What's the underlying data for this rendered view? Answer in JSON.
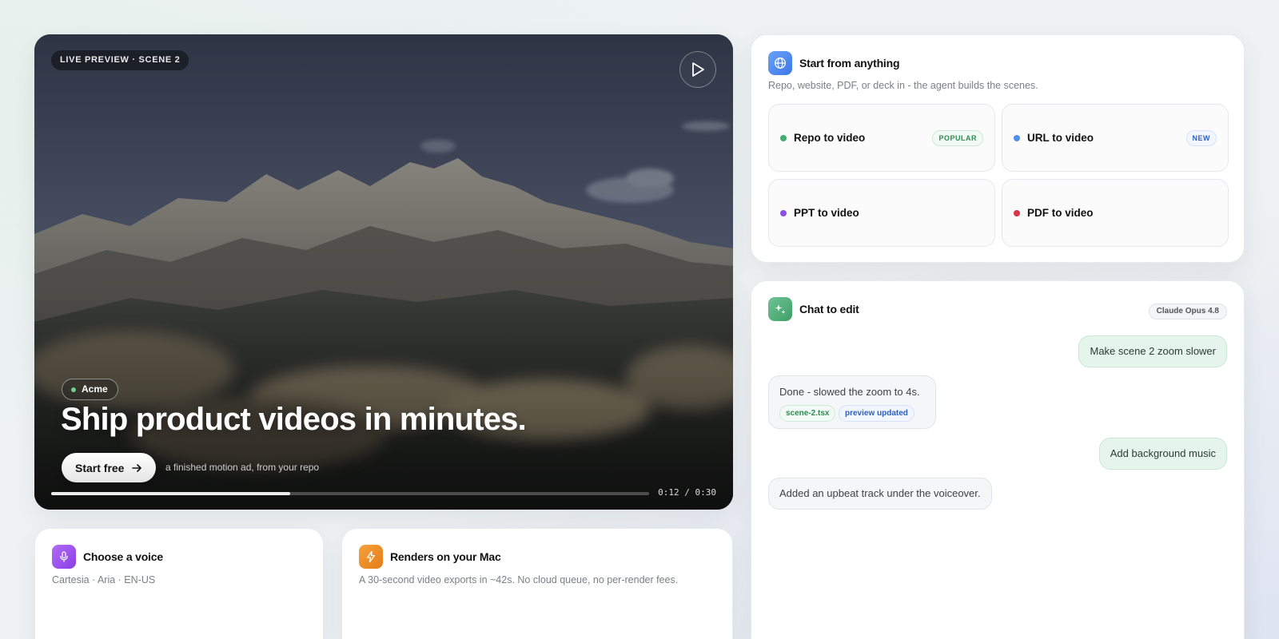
{
  "hero": {
    "live_label": "LIVE PREVIEW · SCENE 2",
    "brand": "Acme",
    "title": "Ship product videos in minutes.",
    "cta_label": "Start free",
    "caption": "a finished motion ad, from your repo",
    "progress_fraction": 0.4,
    "time": "0:12 / 0:30",
    "icons": {
      "play": "play-icon",
      "arrow": "arrow-right-icon"
    }
  },
  "start_card": {
    "title": "Start from anything",
    "subtitle": "Repo, website, PDF, or deck in - the agent builds the scenes.",
    "icon": "globe-icon",
    "options": [
      {
        "label": "Repo to video",
        "dot_color": "#3fae6a",
        "badge": "POPULAR"
      },
      {
        "label": "URL to video",
        "dot_color": "#4f8ff0",
        "badge": "NEW"
      },
      {
        "label": "PPT to video",
        "dot_color": "#8b4fe6",
        "badge": ""
      },
      {
        "label": "PDF to video",
        "dot_color": "#d8344b",
        "badge": ""
      }
    ]
  },
  "chat_card": {
    "title": "Chat to edit",
    "icon": "sparkle-icon",
    "model": "Claude Opus 4.8",
    "messages": [
      {
        "role": "user",
        "text": "Make scene 2 zoom slower"
      },
      {
        "role": "agent",
        "text": "Done - slowed the zoom to 4s.",
        "tags": [
          "scene-2.tsx",
          "preview updated"
        ]
      },
      {
        "role": "user",
        "text": "Add background music"
      },
      {
        "role": "agent",
        "text": "Added an upbeat track under the voiceover."
      }
    ]
  },
  "voice_card": {
    "title": "Choose a voice",
    "subtitle": "Cartesia · Aria · EN-US",
    "icon": "microphone-icon"
  },
  "render_card": {
    "title": "Renders on your Mac",
    "subtitle": "A 30-second video exports in ~42s. No cloud queue, no per-render fees.",
    "icon": "lightning-icon"
  },
  "colors": {
    "accent_green": "#3fae6a",
    "accent_blue": "#4f8ff0",
    "accent_purple": "#8b4fe6",
    "accent_red": "#d8344b",
    "accent_orange": "#f08a24"
  }
}
